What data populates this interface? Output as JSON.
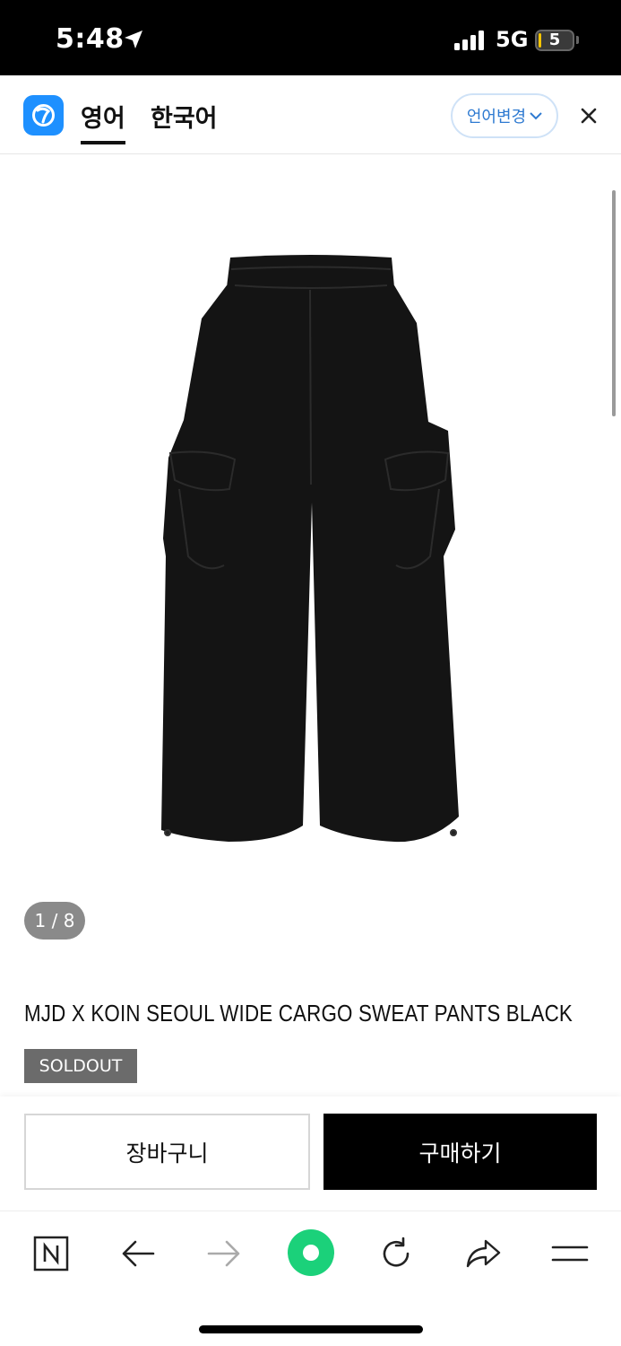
{
  "status_bar": {
    "time": "5:48",
    "network": "5G",
    "battery": "5",
    "battery_level": 0.05
  },
  "translate_bar": {
    "tab_english": "영어",
    "tab_korean": "한국어",
    "language_change": "언어변경"
  },
  "product": {
    "image_counter": "1 / 8",
    "title": "MJD X KOIN SEOUL WIDE CARGO SWEAT PANTS BLACK",
    "badge": "SOLDOUT"
  },
  "actions": {
    "cart": "장바구니",
    "buy": "구매하기"
  },
  "browser_toolbar": {
    "icons": [
      "naver-n-icon",
      "back-arrow-icon",
      "forward-arrow-icon",
      "green-dot-icon",
      "refresh-icon",
      "share-icon",
      "menu-icon"
    ],
    "accent": "#1bd17a"
  }
}
